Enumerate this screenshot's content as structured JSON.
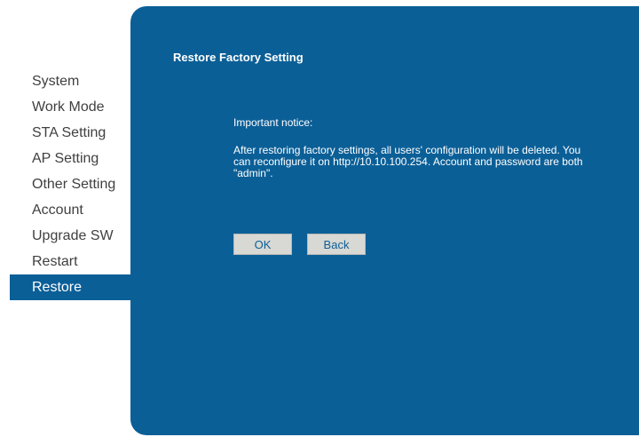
{
  "sidebar": {
    "items": [
      {
        "label": "System",
        "active": false
      },
      {
        "label": "Work Mode",
        "active": false
      },
      {
        "label": "STA Setting",
        "active": false
      },
      {
        "label": "AP Setting",
        "active": false
      },
      {
        "label": "Other Setting",
        "active": false
      },
      {
        "label": "Account",
        "active": false
      },
      {
        "label": "Upgrade SW",
        "active": false
      },
      {
        "label": "Restart",
        "active": false
      },
      {
        "label": "Restore",
        "active": true
      }
    ]
  },
  "main": {
    "title": "Restore Factory Setting",
    "notice_heading": "Important notice:",
    "notice_body": "After restoring factory settings, all users' configuration will be deleted. You can reconfigure it on http://10.10.100.254. Account and password are both \"admin\".",
    "ok_label": "OK",
    "back_label": "Back"
  },
  "colors": {
    "panel": "#0b5f97",
    "button": "#d8d8d4",
    "nav_text": "#404040"
  }
}
